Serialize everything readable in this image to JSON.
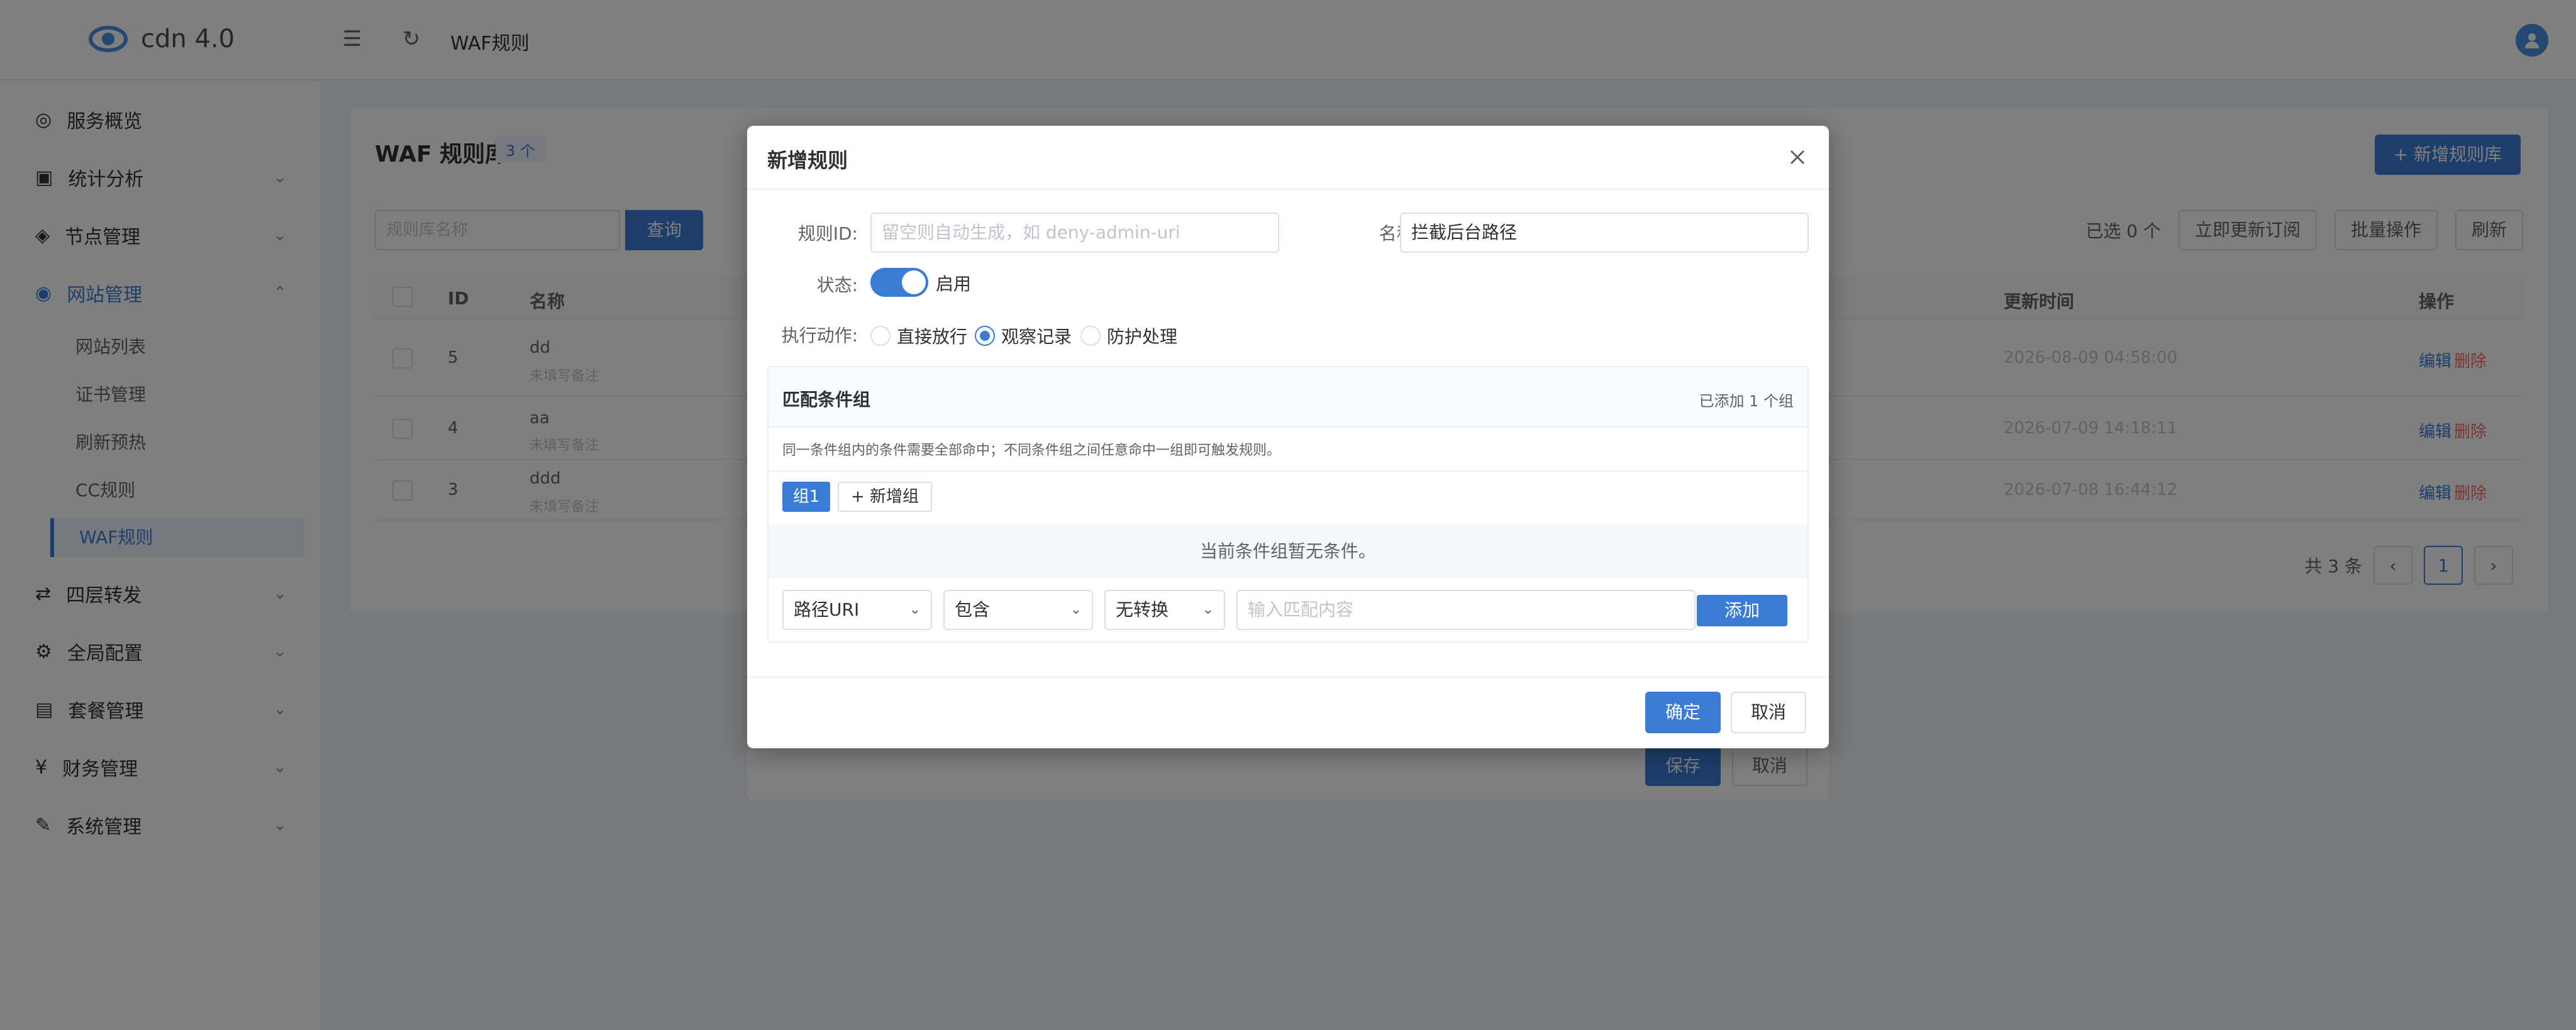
{
  "app": {
    "name": "cdn 4.0",
    "page_title": "WAF规则"
  },
  "colors": {
    "accent": "#3a7bd5",
    "success": "#67c23a",
    "danger": "#f56c6c"
  },
  "sidebar": {
    "items": [
      {
        "label": "服务概览",
        "icon": "dashboard-icon"
      },
      {
        "label": "统计分析",
        "icon": "chart-icon"
      },
      {
        "label": "节点管理",
        "icon": "node-icon"
      },
      {
        "label": "网站管理",
        "icon": "globe-icon"
      },
      {
        "label": "四层转发",
        "icon": "forward-icon"
      },
      {
        "label": "全局配置",
        "icon": "gear-icon"
      },
      {
        "label": "套餐管理",
        "icon": "package-icon"
      },
      {
        "label": "财务管理",
        "icon": "yen-icon"
      },
      {
        "label": "系统管理",
        "icon": "wrench-icon"
      }
    ],
    "subitems": [
      "网站列表",
      "证书管理",
      "刷新预热",
      "CC规则",
      "WAF规则"
    ]
  },
  "content": {
    "title": "WAF 规则库",
    "count_badge": "3 个",
    "add_button": "+ 新增规则库",
    "search_placeholder": "规则库名称",
    "query_button": "查询",
    "selected": "已选 0 个",
    "update_button": "立即更新订阅",
    "batch_button": "批量操作",
    "refresh_button": "刷新",
    "columns": [
      "ID",
      "名称",
      "更新时间",
      "操作"
    ],
    "rows": [
      {
        "id": "5",
        "name": "dd",
        "note": "未填写备注",
        "updated": "2026-08-09 04:58:00"
      },
      {
        "id": "4",
        "name": "aa",
        "note": "未填写备注",
        "updated": "2026-07-09 14:18:11"
      },
      {
        "id": "3",
        "name": "ddd",
        "note": "未填写备注",
        "updated": "2026-07-08 16:44:12"
      }
    ],
    "edit_label": "编辑",
    "delete_label": "删除",
    "total": "共 3 条",
    "page": "1"
  },
  "underlay": {
    "save": "保存",
    "cancel": "取消"
  },
  "dialog": {
    "title": "新增规则",
    "rule_id_label": "规则ID:",
    "rule_id_placeholder": "留空则自动生成，如 deny-admin-uri",
    "name_label": "名称:",
    "name_value": "拦截后台路径",
    "status_label": "状态:",
    "status_text": "启用",
    "action_label": "执行动作:",
    "actions": [
      "直接放行",
      "观察记录",
      "防护处理"
    ],
    "selected_action": "观察记录",
    "group": {
      "title": "匹配条件组",
      "count": "已添加 1 个组",
      "desc": "同一条件组内的条件需要全部命中；不同条件组之间任意命中一组即可触发规则。",
      "tag": "组1",
      "add_group": "+ 新增组",
      "empty": "当前条件组暂无条件。",
      "field": "路径URI",
      "operator": "包含",
      "transform": "无转换",
      "value_placeholder": "输入匹配内容",
      "add_button": "添加"
    },
    "ok": "确定",
    "cancel": "取消"
  }
}
